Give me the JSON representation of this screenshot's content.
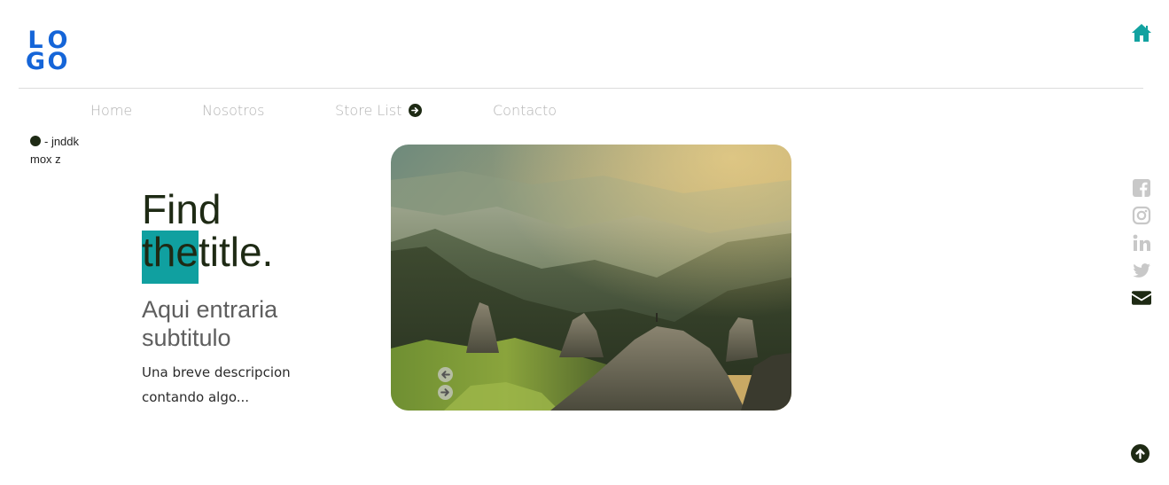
{
  "logo": {
    "letters": [
      "L",
      "O",
      "G",
      "O"
    ]
  },
  "header": {
    "home_icon": "home-icon"
  },
  "nav": {
    "items": [
      {
        "label": "Home"
      },
      {
        "label": "Nosotros"
      },
      {
        "label": "Store List",
        "icon": "arrow-right-circle-icon"
      },
      {
        "label": "Contacto"
      }
    ]
  },
  "note": {
    "line1": "- jnddk",
    "line2": "mox z"
  },
  "hero": {
    "title_line1": "Find",
    "title_highlight": "the",
    "title_rest": "title.",
    "subtitle": "Aqui entraria subtitulo",
    "description": "Una breve descripcion contando algo..."
  },
  "slider": {
    "image": "mountain-landscape",
    "prev_icon": "arrow-left-circle-icon",
    "next_icon": "arrow-right-circle-icon"
  },
  "social": [
    "facebook-icon",
    "instagram-icon",
    "linkedin-icon",
    "twitter-icon",
    "envelope-icon"
  ],
  "colors": {
    "logo": "#1565d8",
    "accent": "#10a0a0",
    "dark": "#1e2a14",
    "nav_text": "#b3b3b3",
    "social_gray": "#c8c8c8"
  }
}
